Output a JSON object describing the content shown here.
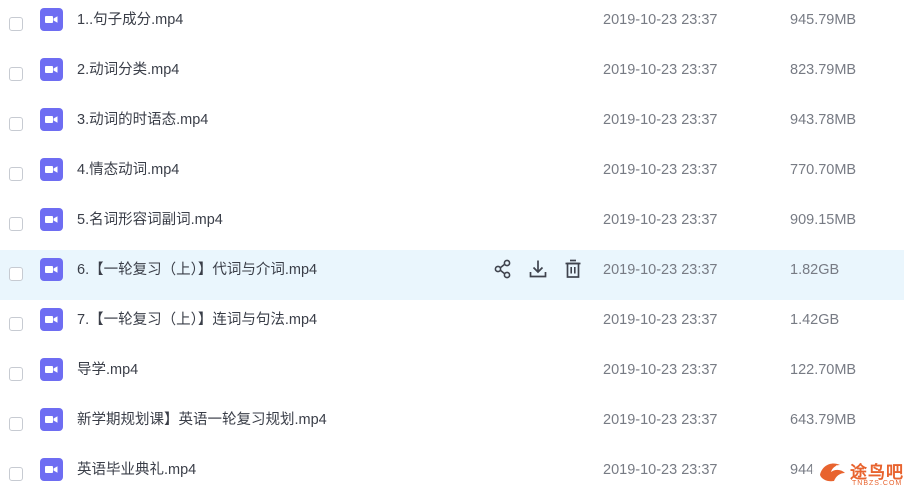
{
  "file_list": {
    "rows": [
      {
        "name": "1..句子成分.mp4",
        "date": "2019-10-23 23:37",
        "size": "945.79MB",
        "icon": "video-file-icon"
      },
      {
        "name": "2.动词分类.mp4",
        "date": "2019-10-23 23:37",
        "size": "823.79MB",
        "icon": "video-file-icon"
      },
      {
        "name": "3.动词的时语态.mp4",
        "date": "2019-10-23 23:37",
        "size": "943.78MB",
        "icon": "video-file-icon"
      },
      {
        "name": "4.情态动词.mp4",
        "date": "2019-10-23 23:37",
        "size": "770.70MB",
        "icon": "video-file-icon"
      },
      {
        "name": "5.名词形容词副词.mp4",
        "date": "2019-10-23 23:37",
        "size": "909.15MB",
        "icon": "video-file-icon"
      },
      {
        "name": "6.【一轮复习（上）】代词与介词.mp4",
        "date": "2019-10-23 23:37",
        "size": "1.82GB",
        "icon": "video-file-icon",
        "hovered": true
      },
      {
        "name": "7.【一轮复习（上）】连词与句法.mp4",
        "date": "2019-10-23 23:37",
        "size": "1.42GB",
        "icon": "video-file-icon"
      },
      {
        "name": "导学.mp4",
        "date": "2019-10-23 23:37",
        "size": "122.70MB",
        "icon": "video-file-icon"
      },
      {
        "name": "新学期规划课】英语一轮复习规划.mp4",
        "date": "2019-10-23 23:37",
        "size": "643.79MB",
        "icon": "video-file-icon"
      },
      {
        "name": "英语毕业典礼.mp4",
        "date": "2019-10-23 23:37",
        "size": "944",
        "icon": "video-file-icon"
      }
    ],
    "row_actions": [
      "share-icon",
      "download-icon",
      "delete-icon"
    ]
  },
  "colors": {
    "file_icon": "#6e6df2",
    "hover_row": "#eaf6fd",
    "action_icon": "#3f434d",
    "watermark": "#e8632e"
  },
  "watermark": {
    "text": "途鸟吧",
    "sub": "TNBZS.COM"
  }
}
